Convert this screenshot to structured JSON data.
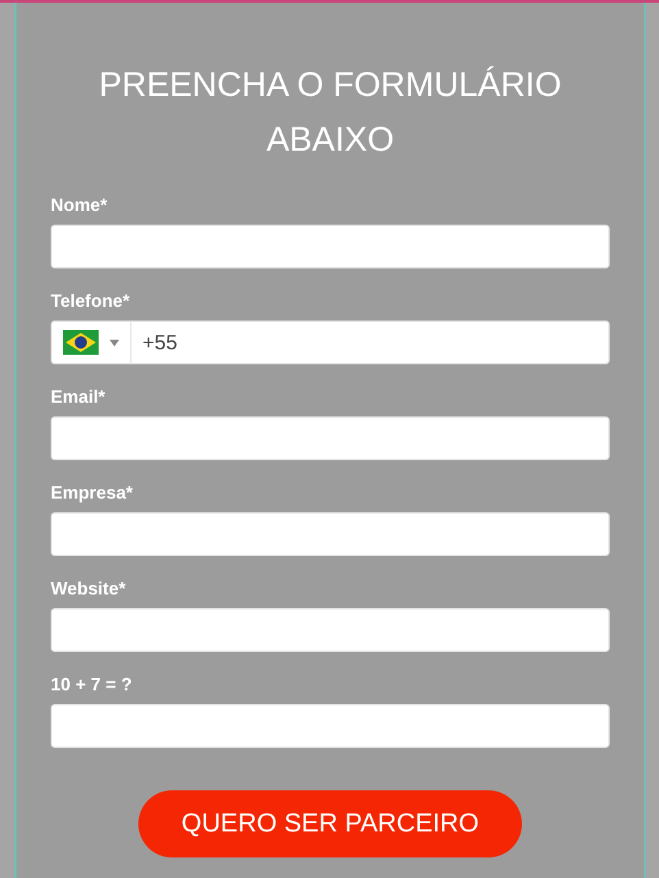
{
  "title": "PREENCHA O FORMULÁRIO ABAIXO",
  "fields": [
    {
      "kind": "text",
      "label": "Nome*"
    },
    {
      "kind": "phone",
      "label": "Telefone*",
      "value": "+55"
    },
    {
      "kind": "text",
      "label": "Email*"
    },
    {
      "kind": "text",
      "label": "Empresa*"
    },
    {
      "kind": "text",
      "label": "Website*"
    },
    {
      "kind": "text",
      "label": "10 + 7 = ?"
    }
  ],
  "submit_button": "QUERO SER PARCEIRO"
}
